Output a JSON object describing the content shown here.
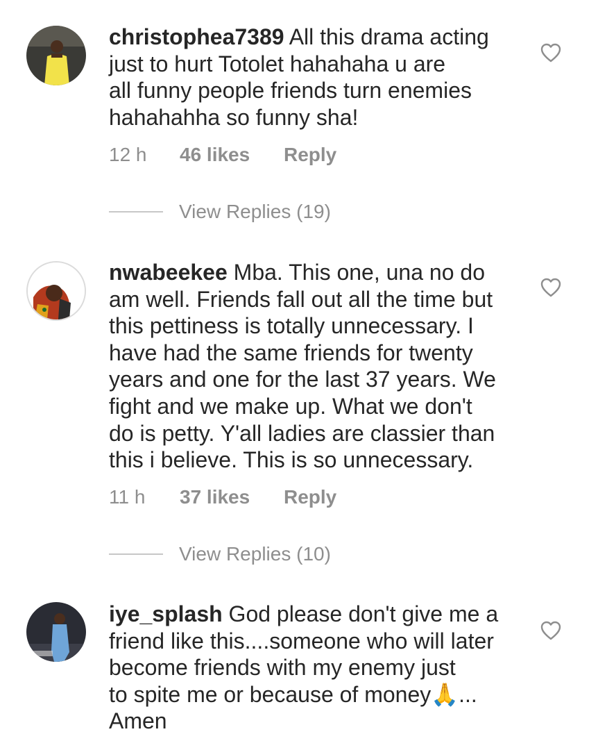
{
  "comments": [
    {
      "username": "christophea7389",
      "text": "All this drama acting just to hurt Totolet hahahaha u are all funny people friends turn enemies hahahahha so funny sha!",
      "lines": [
        {
          "user": "christophea7389",
          "rest": " All this drama acting"
        },
        {
          "user": "",
          "rest": "just to hurt Totolet hahahaha u are"
        },
        {
          "user": "",
          "rest": "all funny people friends turn enemies"
        },
        {
          "user": "",
          "rest": "hahahahha so funny sha!"
        }
      ],
      "time": "12 h",
      "likes": "46 likes",
      "reply_label": "Reply",
      "view_replies": "View Replies (19)",
      "heart_icon": "heart-outline-icon"
    },
    {
      "username": "nwabeekee",
      "text": "Mba. This one, una no do am well. Friends fall out all the time but this pettiness is totally unnecessary. I have had the same friends for twenty years and one for the last 37 years. We fight and we make up. What we don't do is petty. Y'all ladies are classier than this i believe. This is so unnecessary.",
      "lines": [
        {
          "user": "nwabeekee",
          "rest": " Mba. This one, una no do"
        },
        {
          "user": "",
          "rest": "am well. Friends fall out all the time but"
        },
        {
          "user": "",
          "rest": "this pettiness is totally unnecessary. I"
        },
        {
          "user": "",
          "rest": "have had the same friends for twenty"
        },
        {
          "user": "",
          "rest": "years and one for the last 37 years. We"
        },
        {
          "user": "",
          "rest": "fight and we make up. What we don't"
        },
        {
          "user": "",
          "rest": "do is petty. Y'all ladies are classier than"
        },
        {
          "user": "",
          "rest": "this i believe. This is so unnecessary."
        }
      ],
      "time": "11 h",
      "likes": "37 likes",
      "reply_label": "Reply",
      "view_replies": "View Replies (10)",
      "heart_icon": "heart-outline-icon"
    },
    {
      "username": "iye_splash",
      "text": "God please don't give me a friend like this....someone who will later become friends with my enemy just to spite me or because of money🙏... Amen",
      "lines": [
        {
          "user": "iye_splash",
          "rest": " God please don't give me a"
        },
        {
          "user": "",
          "rest": "friend like this....someone who will later"
        },
        {
          "user": "",
          "rest": "become friends with my enemy just"
        },
        {
          "user": "",
          "rest": "to spite me or because of money🙏..."
        },
        {
          "user": "",
          "rest": "Amen"
        }
      ],
      "heart_icon": "heart-outline-icon"
    }
  ]
}
